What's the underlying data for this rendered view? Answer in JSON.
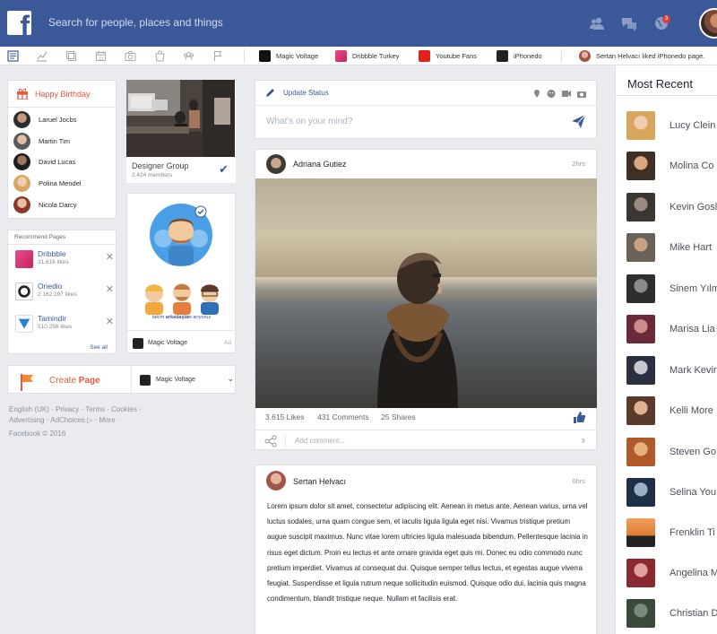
{
  "header": {
    "logo_letter": "f",
    "search_placeholder": "Search for people,  places and things",
    "notification_count": "3"
  },
  "subbar": {
    "pages": [
      "Magic Voltage",
      "Dribbble Turkey",
      "Youtube Fans",
      "iPhonedo"
    ],
    "notice": "Sertan Helvacı liked iPhonedo page."
  },
  "birthday": {
    "title_happy": "Happy ",
    "title_birthday": "Birthday",
    "people": [
      "Laruel Jocbs",
      "Martin Tim",
      "David Lucas",
      "Polina Mendel",
      "Nicola Darcy"
    ]
  },
  "recommend": {
    "title": "Recommend Pages",
    "pages": [
      {
        "name": "Dribbble",
        "likes": "31.616 likes"
      },
      {
        "name": "Onedio",
        "likes": "2.162.197 likes"
      },
      {
        "name": "Tamindir",
        "likes": "510.256 likes"
      }
    ],
    "see_all": "See all"
  },
  "create_page": {
    "label_create": "Create ",
    "label_page": "Page",
    "selected_page": "Magic Voltage"
  },
  "footer": {
    "line1": "English (UK) · Privacy · Terms · Cookies ·",
    "line2": "Advertising · AdChoices ▷ · More ·",
    "line3": "Facebook © 2016"
  },
  "group": {
    "name": "Designer Group",
    "members": "2.424 members"
  },
  "ad": {
    "caption_pre": "takım ",
    "caption_bold": "arkadaşları",
    "caption_post": " arıyoruz",
    "page_name": "Magic Voltage",
    "tag": "Ad"
  },
  "status": {
    "update_label": "Update Status",
    "placeholder": "What's on your mind?"
  },
  "post1": {
    "author": "Adriana Gutiez",
    "time": "2hrs",
    "likes": "3.615 Likes",
    "comments": "431 Comments",
    "shares": "25 Shares",
    "comment_placeholder": "Add comment..."
  },
  "post2": {
    "author": "Sertan Helvacı",
    "time": "6hrs",
    "text": "Lorem ipsum dolor sit amet, consectetur adipiscing elit. Aenean in metus ante. Aenean varius, urna vel luctus sodales, urna quam congue sem, et iaculis ligula ligula eget nisi. Vivamus tristique pretium augue suscipit maximus. Nunc vitae lorem ultricies ligula malesuada bibendum. Pellentesque lacinia in risus eget dictum. Proin eu lectus et ante ornare gravida eget quis mi. Donec eu odio commodo nunc pretium imperdiet. Vivamus at consequat dui. Quisque semper tellus lectus, et egestas augue viverra feugiat. Suspendisse et ligula rutrum neque sollicitudin euismod. Quisque odio dui, lacinia quis magna condimentum, blandit tristique neque. Nullam et facilisis erat."
  },
  "most_recent": {
    "title": "Most Recent",
    "people": [
      "Lucy Clein",
      "Molina Co",
      "Kevin Gosl",
      "Mike Hart",
      "Sinem Yılm",
      "Marisa Lia",
      "Mark Kevin",
      "Kelli More",
      "Steven Go",
      "Selina You",
      "Frenklin Ti",
      "Angelina M",
      "Christian D"
    ]
  },
  "colors": {
    "brand": "#3b5998",
    "accent_orange": "#e9573f",
    "background": "#e9ebee"
  }
}
